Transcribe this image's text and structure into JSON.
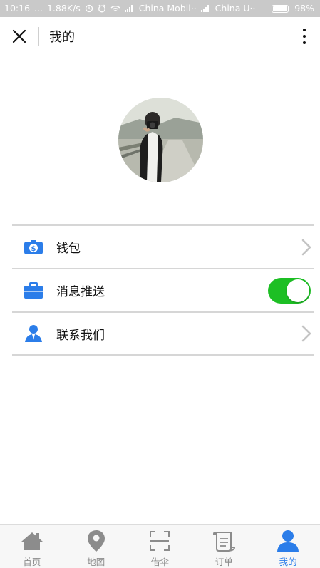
{
  "status_bar": {
    "time": "10:16",
    "dots": "...",
    "speed": "1.88K/s",
    "carrier1": "China Mobil··",
    "carrier2": "China U··",
    "battery": "98%"
  },
  "header": {
    "title": "我的",
    "close_icon": "close-icon",
    "more_icon": "more-vertical-icon"
  },
  "menu": {
    "items": [
      {
        "label": "钱包",
        "icon": "wallet-icon",
        "trailing": "chevron"
      },
      {
        "label": "消息推送",
        "icon": "briefcase-icon",
        "trailing": "toggle",
        "toggle_on": true
      },
      {
        "label": "联系我们",
        "icon": "contact-person-icon",
        "trailing": "chevron"
      }
    ]
  },
  "tabbar": {
    "tabs": [
      {
        "label": "首页",
        "icon": "home-icon",
        "active": false
      },
      {
        "label": "地图",
        "icon": "map-pin-icon",
        "active": false
      },
      {
        "label": "借伞",
        "icon": "scan-icon",
        "active": false
      },
      {
        "label": "订单",
        "icon": "scroll-icon",
        "active": false
      },
      {
        "label": "我的",
        "icon": "person-icon",
        "active": true
      }
    ]
  },
  "colors": {
    "accent_blue": "#2b7de9",
    "toggle_green": "#1dbf24",
    "inactive_gray": "#8c8c8c",
    "divider": "#d6d6d6"
  }
}
